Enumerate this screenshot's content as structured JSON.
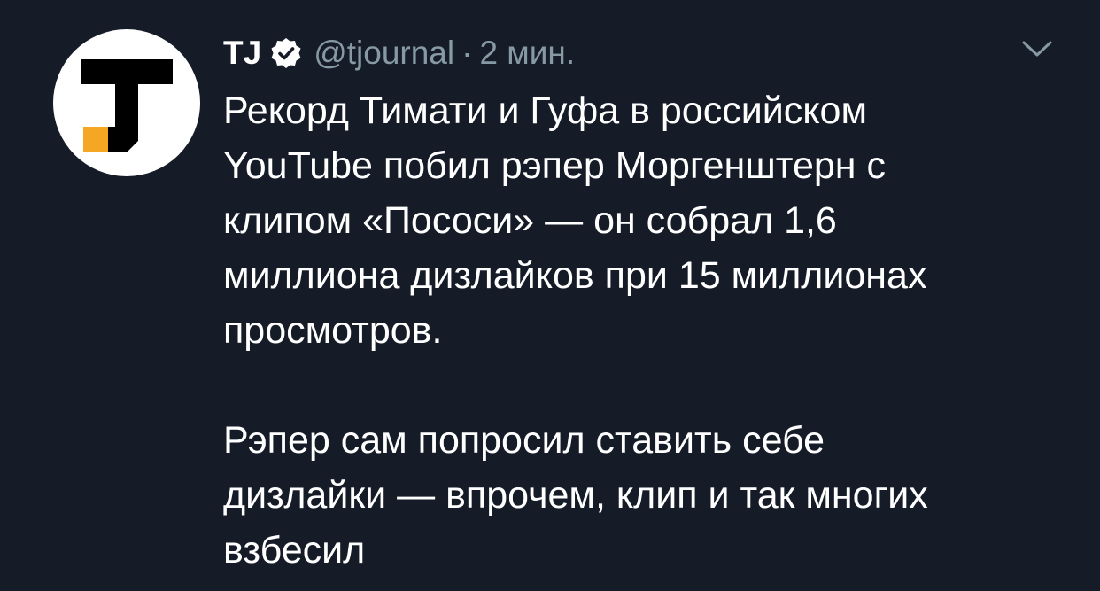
{
  "tweet": {
    "author_name": "TJ",
    "handle": "@tjournal",
    "separator": "·",
    "time": "2 мин.",
    "text": "Рекорд Тимати и Гуфа в российском\nYouTube побил рэпер Моргенштерн с\nклипом «Пососи» — он собрал 1,6\nмиллиона дизлайков при 15 миллионах\nпросмотров.\n\nРэпер сам попросил ставить себе\nдизлайки — впрочем, клип и так многих\nвзбесил"
  },
  "icons": {
    "avatar": "tj-logo-icon",
    "verified": "verified-badge-icon",
    "menu": "chevron-down-icon"
  },
  "colors": {
    "background": "#151c27",
    "text": "#ffffff",
    "secondary_text": "#8899a6",
    "logo_accent": "#f5a623"
  }
}
